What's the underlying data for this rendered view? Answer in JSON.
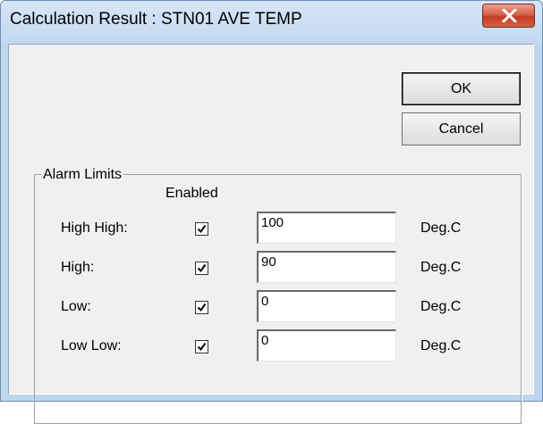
{
  "window": {
    "title": "Calculation Result : STN01 AVE TEMP",
    "close_label": "X"
  },
  "buttons": {
    "ok": "OK",
    "cancel": "Cancel"
  },
  "alarm_limits": {
    "group_label": "Alarm Limits",
    "enabled_header": "Enabled",
    "rows": [
      {
        "label": "High High:",
        "enabled": true,
        "value": "100",
        "unit": "Deg.C"
      },
      {
        "label": "High:",
        "enabled": true,
        "value": "90",
        "unit": "Deg.C"
      },
      {
        "label": "Low:",
        "enabled": true,
        "value": "0",
        "unit": "Deg.C"
      },
      {
        "label": "Low Low:",
        "enabled": true,
        "value": "0",
        "unit": "Deg.C"
      }
    ]
  },
  "colors": {
    "title_bar": "#c3d8f0",
    "close_button": "#c63b24",
    "dialog_face": "#f0f0f0"
  },
  "icons": {
    "close": "close-icon",
    "check": "check-icon"
  }
}
